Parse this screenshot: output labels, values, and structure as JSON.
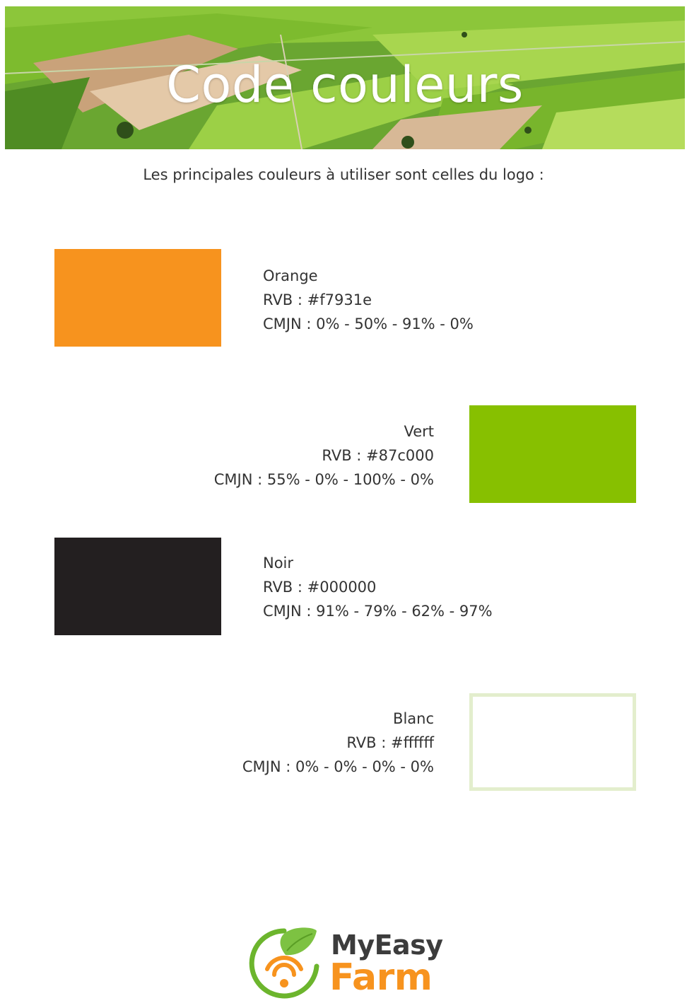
{
  "header": {
    "title": "Code couleurs"
  },
  "intro": "Les principales couleurs à utiliser sont celles du logo :",
  "colors": [
    {
      "name": "Orange",
      "rvb": "RVB : #f7931e",
      "cmjn": "CMJN : 0% - 50% - 91% - 0%",
      "swatch": "#f7931e",
      "border": ""
    },
    {
      "name": "Vert",
      "rvb": "RVB : #87c000",
      "cmjn": "CMJN : 55% - 0% - 100% - 0%",
      "swatch": "#87c000",
      "border": ""
    },
    {
      "name": "Noir",
      "rvb": "RVB : #000000",
      "cmjn": "CMJN : 91% - 79% - 62% - 97%",
      "swatch": "#231f20",
      "border": ""
    },
    {
      "name": "Blanc",
      "rvb": "RVB : #ffffff",
      "cmjn": "CMJN : 0% - 0% - 0% - 0%",
      "swatch": "#ffffff",
      "border": "#e3eecd"
    }
  ],
  "logo": {
    "line1": "MyEasy",
    "line2": "Farm",
    "accent_orange": "#f7931e",
    "accent_green": "#6cb52d",
    "icon": "leaf-wifi-icon"
  }
}
